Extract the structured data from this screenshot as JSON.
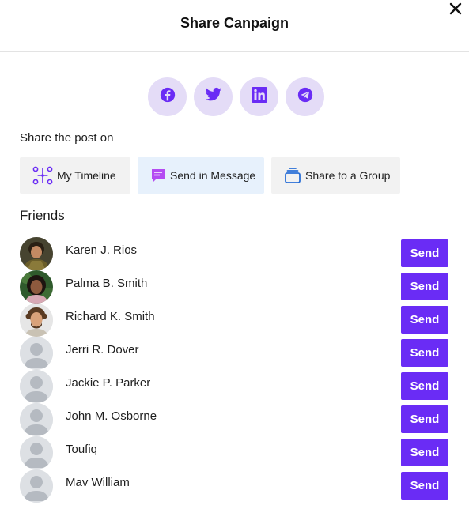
{
  "modal": {
    "title": "Share Canpaign",
    "close_icon": "close-icon"
  },
  "socials": [
    {
      "name": "facebook",
      "icon": "facebook-icon",
      "color": "#6a2cf5"
    },
    {
      "name": "twitter",
      "icon": "twitter-icon",
      "color": "#6a2cf5"
    },
    {
      "name": "linkedin",
      "icon": "linkedin-icon",
      "color": "#6a2cf5"
    },
    {
      "name": "telegram",
      "icon": "telegram-icon",
      "color": "#6a2cf5"
    }
  ],
  "share": {
    "label": "Share the post on",
    "options": [
      {
        "label": "My Timeline",
        "icon": "timeline-icon",
        "active": false
      },
      {
        "label": "Send in Message",
        "icon": "message-icon",
        "active": true
      },
      {
        "label": "Share to a Group",
        "icon": "group-icon",
        "active": false
      }
    ]
  },
  "friends": {
    "title": "Friends",
    "send_label": "Send",
    "items": [
      {
        "name": "Karen J. Rios",
        "avatar": "photo"
      },
      {
        "name": "Palma B. Smith",
        "avatar": "photo"
      },
      {
        "name": "Richard K. Smith",
        "avatar": "photo"
      },
      {
        "name": "Jerri R. Dover",
        "avatar": "placeholder"
      },
      {
        "name": "Jackie P. Parker",
        "avatar": "placeholder"
      },
      {
        "name": "John M. Osborne",
        "avatar": "placeholder"
      },
      {
        "name": "Toufiq",
        "avatar": "placeholder"
      },
      {
        "name": "Mav William",
        "avatar": "placeholder"
      }
    ]
  },
  "colors": {
    "accent": "#6a2cf5",
    "social_bg": "#e4dcf7",
    "active_option_bg": "#e7f1fc",
    "option_bg": "#f2f2f2"
  }
}
